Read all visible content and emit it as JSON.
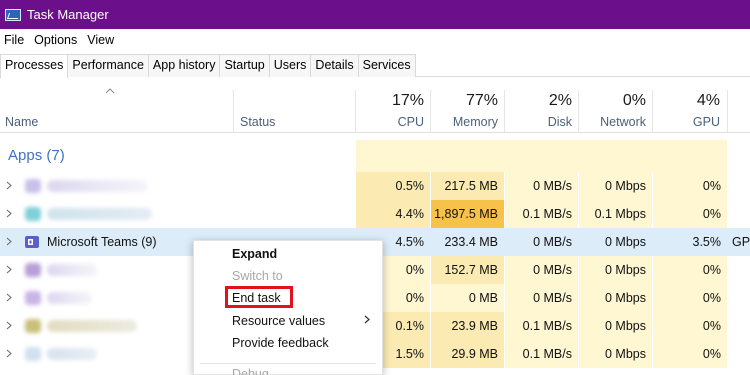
{
  "window": {
    "title": "Task Manager"
  },
  "menu": [
    "File",
    "Options",
    "View"
  ],
  "tabs": [
    "Processes",
    "Performance",
    "App history",
    "Startup",
    "Users",
    "Details",
    "Services"
  ],
  "columns": {
    "name": "Name",
    "status": "Status",
    "cpu": {
      "pct": "17%",
      "label": "CPU"
    },
    "memory": {
      "pct": "77%",
      "label": "Memory"
    },
    "disk": {
      "pct": "2%",
      "label": "Disk"
    },
    "network": {
      "pct": "0%",
      "label": "Network"
    },
    "gpu": {
      "pct": "4%",
      "label": "GPU"
    }
  },
  "group": {
    "label": "Apps (7)"
  },
  "rows": [
    {
      "name": "",
      "cpu": "0.5%",
      "memory": "217.5 MB",
      "disk": "0 MB/s",
      "network": "0 Mbps",
      "gpu": "0%"
    },
    {
      "name": "",
      "cpu": "4.4%",
      "memory": "1,897.5 MB",
      "disk": "0.1 MB/s",
      "network": "0.1 Mbps",
      "gpu": "0%"
    },
    {
      "name": "Microsoft Teams (9)",
      "cpu": "4.5%",
      "memory": "233.4 MB",
      "disk": "0 MB/s",
      "network": "0 Mbps",
      "gpu": "3.5%",
      "gpu_engine": "GPU"
    },
    {
      "name": "",
      "cpu": "0%",
      "memory": "152.7 MB",
      "disk": "0 MB/s",
      "network": "0 Mbps",
      "gpu": "0%"
    },
    {
      "name": "",
      "cpu": "0%",
      "memory": "0 MB",
      "disk": "0 MB/s",
      "network": "0 Mbps",
      "gpu": "0%"
    },
    {
      "name": "",
      "cpu": "0.1%",
      "memory": "23.9 MB",
      "disk": "0.1 MB/s",
      "network": "0 Mbps",
      "gpu": "0%"
    },
    {
      "name": "",
      "cpu": "1.5%",
      "memory": "29.9 MB",
      "disk": "0.1 MB/s",
      "network": "0 Mbps",
      "gpu": "0%"
    }
  ],
  "context_menu": {
    "expand": "Expand",
    "switch_to": "Switch to",
    "end_task": "End task",
    "resource_values": "Resource values",
    "provide_feedback": "Provide feedback",
    "debug": "Debug"
  },
  "colors": {
    "titlebar": "#6b0f8a",
    "group_label": "#3e73c8",
    "highlight_box": "#e0121d",
    "hot_cell": "#f7c24a"
  }
}
